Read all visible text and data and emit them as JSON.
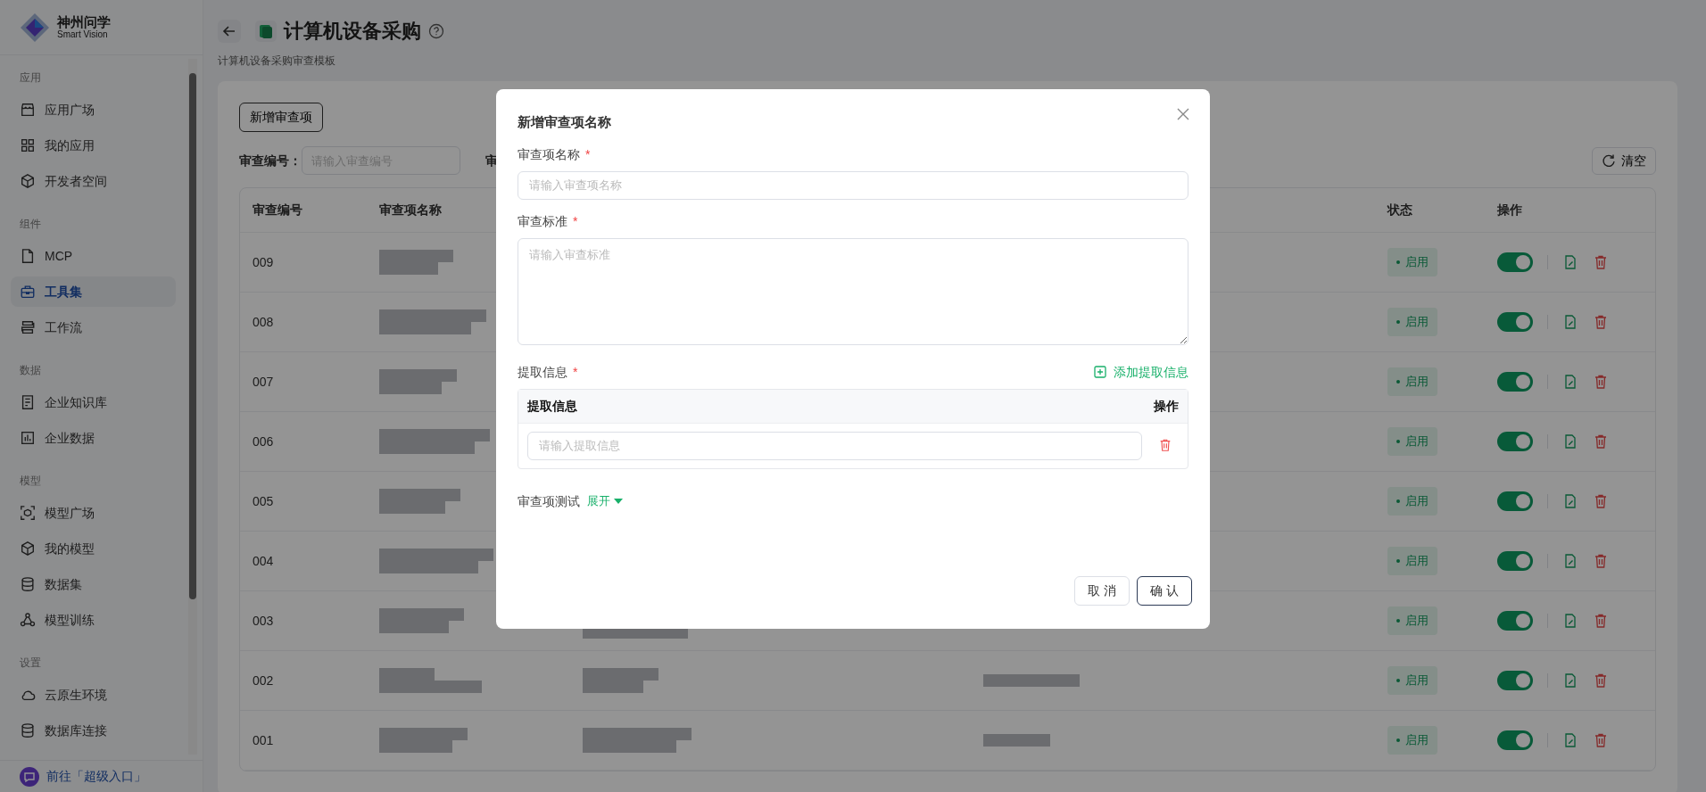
{
  "sidebar": {
    "brand": {
      "name": "神州问学",
      "tagline": "Smart Vision"
    },
    "sections": [
      {
        "title": "应用",
        "items": [
          {
            "label": "应用广场",
            "selected": false
          },
          {
            "label": "我的应用",
            "selected": false
          },
          {
            "label": "开发者空间",
            "selected": false
          }
        ]
      },
      {
        "title": "组件",
        "items": [
          {
            "label": "MCP",
            "selected": false
          },
          {
            "label": "工具集",
            "selected": true
          },
          {
            "label": "工作流",
            "selected": false
          }
        ]
      },
      {
        "title": "数据",
        "items": [
          {
            "label": "企业知识库",
            "selected": false
          },
          {
            "label": "企业数据",
            "selected": false
          }
        ]
      },
      {
        "title": "模型",
        "items": [
          {
            "label": "模型广场",
            "selected": false
          },
          {
            "label": "我的模型",
            "selected": false
          },
          {
            "label": "数据集",
            "selected": false
          },
          {
            "label": "模型训练",
            "selected": false
          }
        ]
      },
      {
        "title": "设置",
        "items": [
          {
            "label": "云原生环境",
            "selected": false
          },
          {
            "label": "数据库连接",
            "selected": false
          }
        ]
      }
    ],
    "footer_link": "前往「超级入口」"
  },
  "header": {
    "title": "计算机设备采购",
    "subtitle": "计算机设备采购审查模板"
  },
  "toolbar": {
    "add_button": "新增审查项",
    "filters": [
      {
        "label": "审查编号：",
        "placeholder": "请输入审查编号"
      },
      {
        "label": "审"
      }
    ],
    "clear_button": "清空"
  },
  "table": {
    "columns": [
      "审查编号",
      "审查项名称",
      "状态",
      "操作"
    ],
    "rows": [
      {
        "id": "009",
        "status": "启用",
        "enabled": true
      },
      {
        "id": "008",
        "status": "启用",
        "enabled": true
      },
      {
        "id": "007",
        "status": "启用",
        "enabled": true
      },
      {
        "id": "006",
        "status": "启用",
        "enabled": true
      },
      {
        "id": "005",
        "status": "启用",
        "enabled": true
      },
      {
        "id": "004",
        "status": "启用",
        "enabled": true
      },
      {
        "id": "003",
        "status": "启用",
        "enabled": true
      },
      {
        "id": "002",
        "status": "启用",
        "enabled": true
      },
      {
        "id": "001",
        "status": "启用",
        "enabled": true
      }
    ]
  },
  "dialog": {
    "title": "新增审查项名称",
    "fields": [
      {
        "label": "审查项名称",
        "required_mark": "*",
        "kind": "input",
        "placeholder": "请输入审查项名称"
      },
      {
        "label": "审查标准",
        "required_mark": "*",
        "kind": "textarea",
        "placeholder": "请输入审查标准"
      }
    ],
    "extract": {
      "label": "提取信息",
      "required_mark": "*",
      "add_link": "添加提取信息",
      "columns": [
        "提取信息",
        "操作"
      ],
      "rows": [
        {
          "placeholder": "请输入提取信息"
        }
      ]
    },
    "test": {
      "label": "审查项测试",
      "toggle": "展开",
      "expanded": false
    },
    "buttons": [
      {
        "label": "取 消",
        "primary": false
      },
      {
        "label": "确 认",
        "primary": true
      }
    ]
  }
}
